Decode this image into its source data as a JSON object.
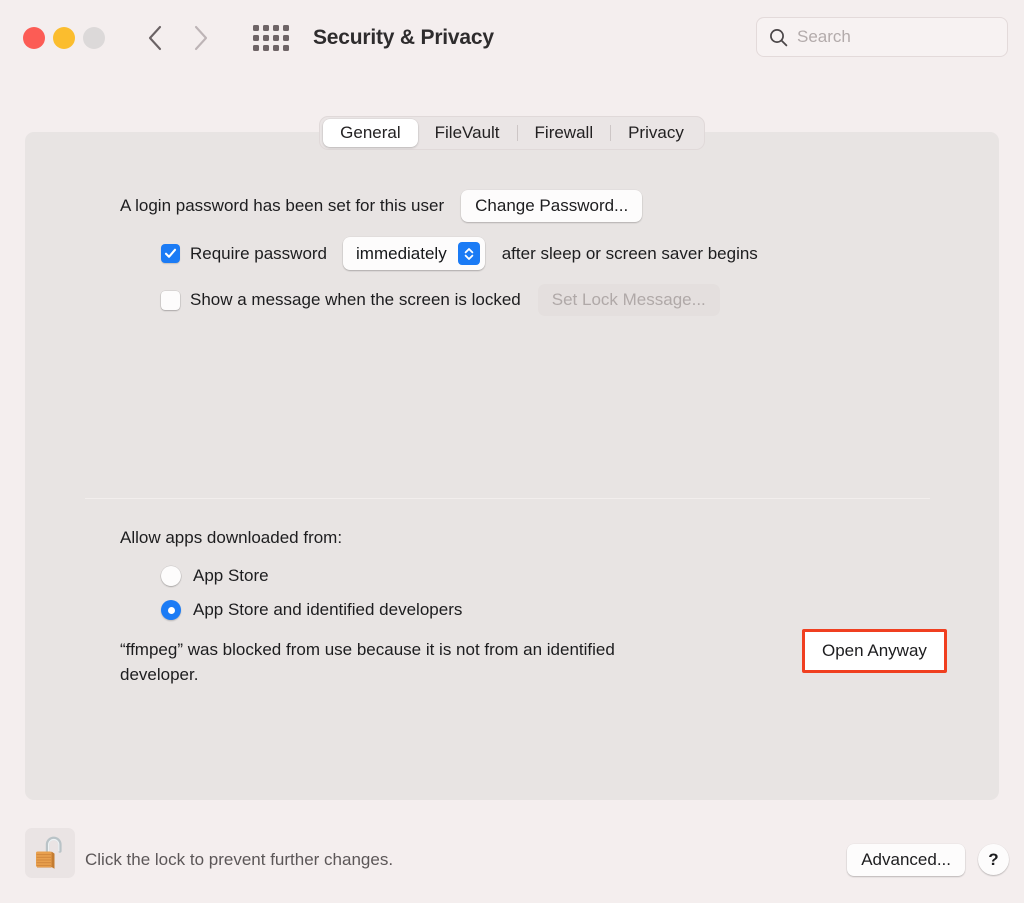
{
  "window": {
    "title": "Security & Privacy",
    "traffic_lights": [
      {
        "name": "close",
        "color": "#fc5c55"
      },
      {
        "name": "minimize",
        "color": "#fbbd2e"
      },
      {
        "name": "zoom",
        "color": "#dcd9d9"
      }
    ],
    "nav": {
      "back_icon": "chevron-left-icon",
      "forward_icon": "chevron-right-icon"
    },
    "grid_icon": "show-all-grid-icon"
  },
  "search": {
    "icon": "search-icon",
    "placeholder": "Search",
    "value": ""
  },
  "tabs": [
    {
      "label": "General",
      "selected": true
    },
    {
      "label": "FileVault",
      "selected": false
    },
    {
      "label": "Firewall",
      "selected": false
    },
    {
      "label": "Privacy",
      "selected": false
    }
  ],
  "general": {
    "login_password_text": "A login password has been set for this user",
    "change_password_label": "Change Password...",
    "require_password": {
      "checked": true,
      "label": "Require password",
      "delay_value": "immediately",
      "suffix": "after sleep or screen saver begins"
    },
    "lock_message": {
      "checked": false,
      "label": "Show a message when the screen is locked",
      "button_label": "Set Lock Message...",
      "button_disabled": true
    }
  },
  "gatekeeper": {
    "heading": "Allow apps downloaded from:",
    "options": [
      {
        "label": "App Store",
        "selected": false
      },
      {
        "label": "App Store and identified developers",
        "selected": true
      }
    ],
    "blocked_message": "“ffmpeg” was blocked from use because it is not from an identified developer.",
    "open_anyway_label": "Open Anyway",
    "highlight_color": "#f03f20"
  },
  "footer": {
    "lock_icon": "unlocked-padlock-icon",
    "lock_note": "Click the lock to prevent further changes.",
    "advanced_label": "Advanced...",
    "help_label": "?"
  },
  "colors": {
    "accent": "#1b7bf5",
    "window_bg": "#f4eeee",
    "panel_bg": "#e8e4e3"
  }
}
